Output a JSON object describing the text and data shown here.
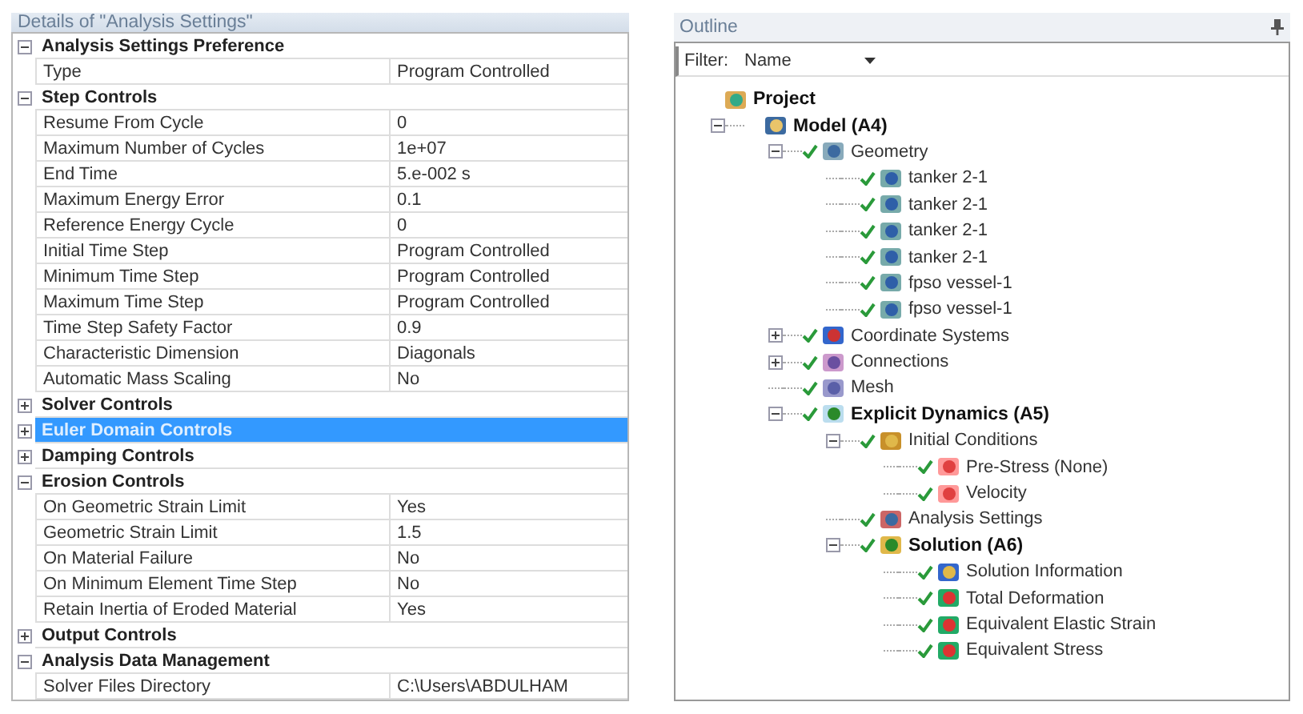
{
  "details": {
    "title": "Details of \"Analysis Settings\"",
    "rows": [
      {
        "kind": "group",
        "label": "Analysis Settings Preference",
        "expanded": true,
        "selected": false
      },
      {
        "kind": "property",
        "label": "Type",
        "value": "Program Controlled"
      },
      {
        "kind": "group",
        "label": "Step Controls",
        "expanded": true,
        "selected": false
      },
      {
        "kind": "property",
        "label": "Resume From Cycle",
        "value": "0"
      },
      {
        "kind": "property",
        "label": "Maximum Number of Cycles",
        "value": "1e+07"
      },
      {
        "kind": "property",
        "label": "End Time",
        "value": "5.e-002 s"
      },
      {
        "kind": "property",
        "label": "Maximum Energy Error",
        "value": "0.1"
      },
      {
        "kind": "property",
        "label": "Reference Energy Cycle",
        "value": "0"
      },
      {
        "kind": "property",
        "label": "Initial Time Step",
        "value": "Program Controlled"
      },
      {
        "kind": "property",
        "label": "Minimum Time Step",
        "value": "Program Controlled"
      },
      {
        "kind": "property",
        "label": "Maximum Time Step",
        "value": "Program Controlled"
      },
      {
        "kind": "property",
        "label": "Time Step Safety Factor",
        "value": "0.9"
      },
      {
        "kind": "property",
        "label": "Characteristic Dimension",
        "value": "Diagonals"
      },
      {
        "kind": "property",
        "label": "Automatic Mass Scaling",
        "value": "No"
      },
      {
        "kind": "group",
        "label": "Solver Controls",
        "expanded": false,
        "selected": false
      },
      {
        "kind": "group",
        "label": "Euler Domain Controls",
        "expanded": false,
        "selected": true
      },
      {
        "kind": "group",
        "label": "Damping Controls",
        "expanded": false,
        "selected": false
      },
      {
        "kind": "group",
        "label": "Erosion Controls",
        "expanded": true,
        "selected": false
      },
      {
        "kind": "property",
        "label": "On Geometric Strain Limit",
        "value": "Yes"
      },
      {
        "kind": "property",
        "label": "Geometric Strain Limit",
        "value": "1.5"
      },
      {
        "kind": "property",
        "label": "On Material Failure",
        "value": "No"
      },
      {
        "kind": "property",
        "label": "On Minimum Element Time Step",
        "value": "No"
      },
      {
        "kind": "property",
        "label": "Retain Inertia of Eroded Material",
        "value": "Yes"
      },
      {
        "kind": "group",
        "label": "Output Controls",
        "expanded": false,
        "selected": false
      },
      {
        "kind": "group",
        "label": "Analysis Data Management",
        "expanded": true,
        "selected": false
      },
      {
        "kind": "property",
        "label": "Solver Files Directory",
        "value": "C:\\Users\\ABDULHAM"
      }
    ]
  },
  "outline": {
    "title": "Outline",
    "filter": {
      "label": "Filter:",
      "value": "Name"
    },
    "tree": [
      {
        "label": "Project",
        "kind": "project",
        "bold": true,
        "checked": false,
        "children": [
          {
            "label": "Model (A4)",
            "kind": "model",
            "bold": true,
            "checked": false,
            "expanded": true,
            "children": [
              {
                "label": "Geometry",
                "kind": "geometry",
                "bold": false,
                "checked": true,
                "expanded": true,
                "children": [
                  {
                    "label": "tanker 2-1",
                    "kind": "part",
                    "bold": false,
                    "checked": true
                  },
                  {
                    "label": "tanker 2-1",
                    "kind": "part",
                    "bold": false,
                    "checked": true
                  },
                  {
                    "label": "tanker 2-1",
                    "kind": "part",
                    "bold": false,
                    "checked": true
                  },
                  {
                    "label": "tanker 2-1",
                    "kind": "part",
                    "bold": false,
                    "checked": true
                  },
                  {
                    "label": "fpso vessel-1",
                    "kind": "part",
                    "bold": false,
                    "checked": true
                  },
                  {
                    "label": "fpso vessel-1",
                    "kind": "part",
                    "bold": false,
                    "checked": true
                  }
                ]
              },
              {
                "label": "Coordinate Systems",
                "kind": "axes",
                "bold": false,
                "checked": true,
                "expanded": false
              },
              {
                "label": "Connections",
                "kind": "connections",
                "bold": false,
                "checked": true,
                "expanded": false
              },
              {
                "label": "Mesh",
                "kind": "mesh",
                "bold": false,
                "checked": true
              },
              {
                "label": "Explicit Dynamics (A5)",
                "kind": "analysis",
                "bold": true,
                "checked": true,
                "expanded": true,
                "children": [
                  {
                    "label": "Initial Conditions",
                    "kind": "folder",
                    "bold": false,
                    "checked": true,
                    "expanded": true,
                    "children": [
                      {
                        "label": "Pre-Stress (None)",
                        "kind": "load",
                        "bold": false,
                        "checked": true
                      },
                      {
                        "label": "Velocity",
                        "kind": "load",
                        "bold": false,
                        "checked": true
                      }
                    ]
                  },
                  {
                    "label": "Analysis Settings",
                    "kind": "settings",
                    "bold": false,
                    "checked": true
                  },
                  {
                    "label": "Solution (A6)",
                    "kind": "solution",
                    "bold": true,
                    "checked": true,
                    "expanded": true,
                    "children": [
                      {
                        "label": "Solution Information",
                        "kind": "info",
                        "bold": false,
                        "checked": true
                      },
                      {
                        "label": "Total Deformation",
                        "kind": "result",
                        "bold": false,
                        "checked": true
                      },
                      {
                        "label": "Equivalent Elastic Strain",
                        "kind": "result",
                        "bold": false,
                        "checked": true
                      },
                      {
                        "label": "Equivalent Stress",
                        "kind": "result",
                        "bold": false,
                        "checked": true
                      }
                    ]
                  }
                ]
              }
            ]
          }
        ]
      }
    ]
  }
}
